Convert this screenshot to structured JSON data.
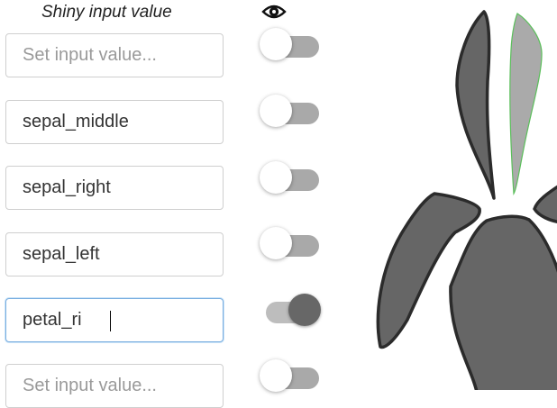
{
  "header": {
    "title": "Shiny input value",
    "visibility_icon": "eye-icon"
  },
  "rows": [
    {
      "value": "",
      "placeholder": "Set input value...",
      "visible": false
    },
    {
      "value": "sepal_middle",
      "placeholder": "Set input value...",
      "visible": false
    },
    {
      "value": "sepal_right",
      "placeholder": "Set input value...",
      "visible": false
    },
    {
      "value": "sepal_left",
      "placeholder": "Set input value...",
      "visible": false
    },
    {
      "value": "petal_ri",
      "placeholder": "Set input value...",
      "visible": true
    },
    {
      "value": "",
      "placeholder": "Set input value...",
      "visible": false
    }
  ],
  "colors": {
    "shape_fill": "#666666",
    "shape_outline": "#2b2b2b",
    "selected_fill": "#aaaaaa",
    "selected_outline": "#5bbf5b",
    "toggle_off_track": "#a9a9a9",
    "toggle_on_knob": "#676767",
    "focus_border": "#79aee0"
  }
}
